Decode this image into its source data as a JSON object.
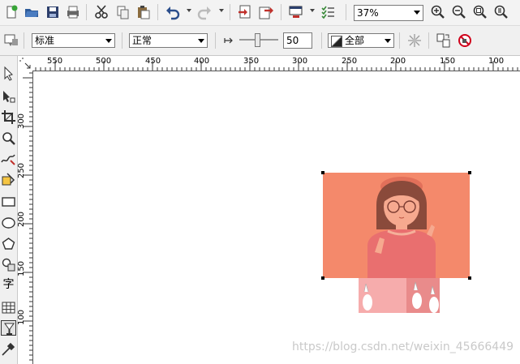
{
  "toolbar": {
    "zoom_value": "37%",
    "icons": [
      "new-document",
      "open-folder",
      "save",
      "print",
      "cut",
      "copy",
      "paste",
      "undo",
      "redo",
      "import",
      "export",
      "application-launcher",
      "options",
      "zoom-in",
      "zoom-out",
      "zoom-fit",
      "zoom-page"
    ]
  },
  "property_bar": {
    "style_select": "标准",
    "mode_select": "正常",
    "transparency_value": "50",
    "target_select": "全部"
  },
  "rulers": {
    "horizontal_labels": [
      "550",
      "500",
      "450",
      "400",
      "350",
      "300",
      "250",
      "200",
      "150",
      "100"
    ],
    "vertical_labels": [
      "300",
      "250",
      "200",
      "150",
      "100"
    ]
  },
  "toolbox": {
    "text_tool_label": "字"
  },
  "watermark": "https://blog.csdn.net/weixin_45666449",
  "colors": {
    "selection_fill": "#f4896b",
    "sweater": "#f08a8a"
  }
}
